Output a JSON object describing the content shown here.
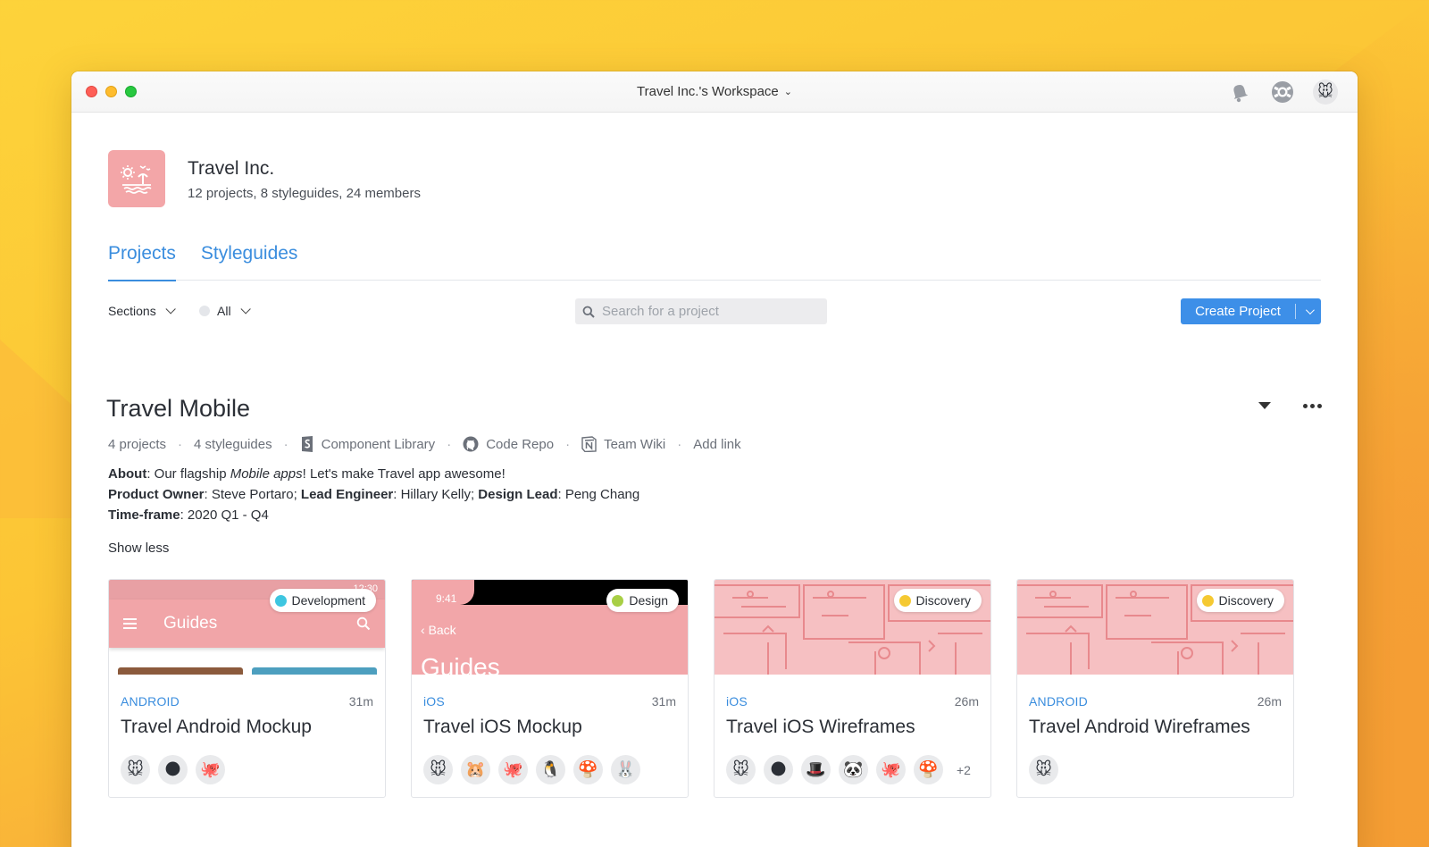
{
  "window": {
    "title": "Travel Inc.'s Workspace"
  },
  "org": {
    "name": "Travel Inc.",
    "meta": "12 projects, 8 styleguides, 24 members"
  },
  "tabs": [
    {
      "label": "Projects",
      "active": true
    },
    {
      "label": "Styleguides",
      "active": false
    }
  ],
  "toolbar": {
    "sections_label": "Sections",
    "filter_label": "All",
    "search_placeholder": "Search for a project",
    "create_label": "Create Project"
  },
  "section": {
    "title": "Travel Mobile",
    "projects_count": "4 projects",
    "styleguides_count": "4 styleguides",
    "links": [
      "Component Library",
      "Code Repo",
      "Team Wiki"
    ],
    "add_link": "Add link",
    "about_label": "About",
    "about_pre": ": Our flagship ",
    "about_em": "Mobile apps",
    "about_post": "! Let's make Travel app awesome!",
    "owner_label": "Product Owner",
    "owner": ": Steve Portaro; ",
    "lead_eng_label": "Lead Engineer",
    "lead_eng": ": Hillary Kelly; ",
    "design_lead_label": "Design Lead",
    "design_lead": ": Peng Chang",
    "timeframe_label": "Time-frame",
    "timeframe": ": 2020 Q1 - Q4",
    "show_less": "Show less"
  },
  "cards": [
    {
      "status": "Development",
      "status_color": "#3ec6e0",
      "platform": "ANDROID",
      "age": "31m",
      "title": "Travel Android Mockup",
      "thumb_title": "Guides",
      "thumb_time": "12:30",
      "avatars": [
        "🐭",
        "🌑",
        "🐙"
      ],
      "more": ""
    },
    {
      "status": "Design",
      "status_color": "#a8cf45",
      "platform": "iOS",
      "age": "31m",
      "title": "Travel iOS Mockup",
      "thumb_title": "Guides",
      "thumb_time": "9:41",
      "thumb_back": "Back",
      "avatars": [
        "🐭",
        "🐹",
        "🐙",
        "🐧",
        "🍄",
        "🐰"
      ],
      "more": ""
    },
    {
      "status": "Discovery",
      "status_color": "#f5c932",
      "platform": "iOS",
      "age": "26m",
      "title": "Travel iOS Wireframes",
      "avatars": [
        "🐭",
        "🌑",
        "🎩",
        "🐼",
        "🐙",
        "🍄"
      ],
      "more": "+2"
    },
    {
      "status": "Discovery",
      "status_color": "#f5c932",
      "platform": "ANDROID",
      "age": "26m",
      "title": "Travel Android Wireframes",
      "avatars": [
        "🐭"
      ],
      "more": ""
    }
  ]
}
